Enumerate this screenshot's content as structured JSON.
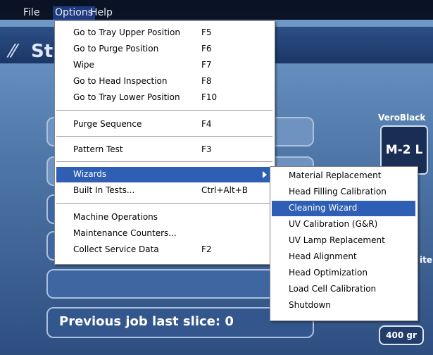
{
  "menubar": {
    "file": "File",
    "options": "Options",
    "help": "Help"
  },
  "app": {
    "logo_text": "St",
    "status_text": "Previous job last slice: 0",
    "material_name": "VeroBlack",
    "material_slot": "M-2 L",
    "side_text": "ite",
    "weight": "400 gr"
  },
  "options_menu": {
    "items": [
      {
        "label": "Go to Tray Upper Position",
        "shortcut": "F5"
      },
      {
        "label": "Go to Purge Position",
        "shortcut": "F6"
      },
      {
        "label": "Wipe",
        "shortcut": "F7"
      },
      {
        "label": "Go to Head Inspection",
        "shortcut": "F8"
      },
      {
        "label": "Go to Tray Lower Position",
        "shortcut": "F10"
      },
      {
        "label": "Purge Sequence",
        "shortcut": "F4"
      },
      {
        "label": "Pattern Test",
        "shortcut": "F3"
      },
      {
        "label": "Wizards",
        "shortcut": ""
      },
      {
        "label": "Built In Tests...",
        "shortcut": "Ctrl+Alt+B"
      },
      {
        "label": "Machine Operations",
        "shortcut": ""
      },
      {
        "label": "Maintenance Counters...",
        "shortcut": ""
      },
      {
        "label": "Collect Service Data",
        "shortcut": "F2"
      }
    ]
  },
  "wizards_menu": {
    "items": [
      "Material Replacement",
      "Head Filling Calibration",
      "Cleaning Wizard",
      "UV Calibration (G&R)",
      "UV Lamp Replacement",
      "Head Alignment",
      "Head Optimization",
      "Load Cell Calibration",
      "Shutdown"
    ],
    "highlighted": "Cleaning Wizard"
  },
  "colors": {
    "highlight": "#2f5fb4",
    "menubar": "#0a1326"
  }
}
